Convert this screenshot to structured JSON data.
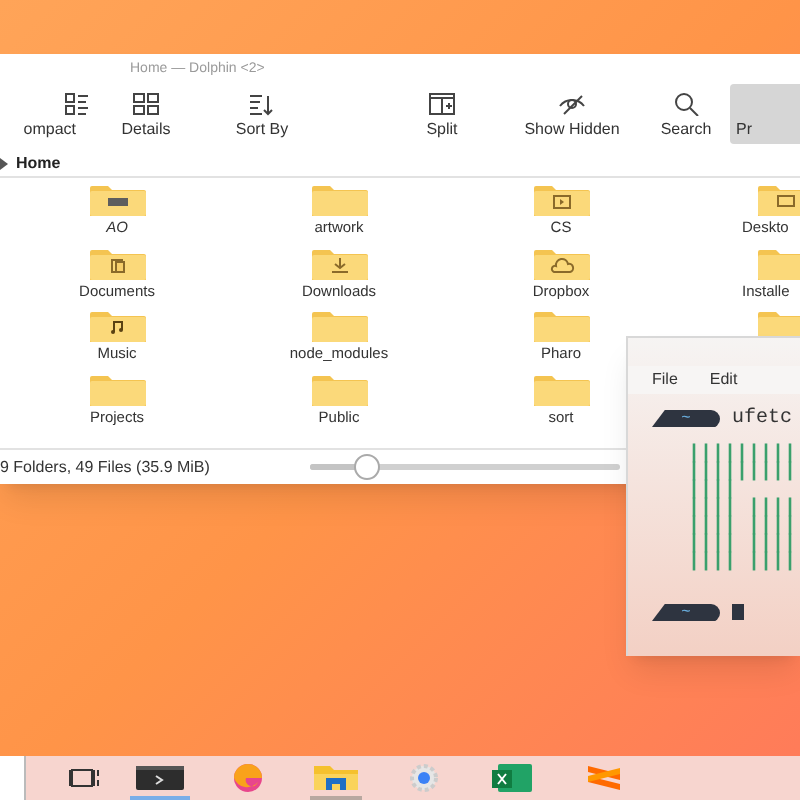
{
  "dolphin": {
    "title": "Home — Dolphin <2>",
    "toolbar": [
      {
        "label": "ompact",
        "kind": "compact",
        "selected": false
      },
      {
        "label": "Details",
        "kind": "details",
        "selected": false
      },
      {
        "label": "Sort By",
        "kind": "sort",
        "selected": false
      },
      {
        "label": "Split",
        "kind": "split",
        "selected": false
      },
      {
        "label": "Show Hidden",
        "kind": "hidden",
        "selected": false
      },
      {
        "label": "Search",
        "kind": "search",
        "selected": false
      },
      {
        "label": "Pr",
        "kind": "preview",
        "selected": true
      }
    ],
    "breadcrumb": "Home",
    "items": [
      {
        "label": "AO",
        "kind": "drive"
      },
      {
        "label": "artwork",
        "kind": "plain"
      },
      {
        "label": "CS",
        "kind": "media"
      },
      {
        "label": "Deskto",
        "kind": "desktop"
      },
      {
        "label": "Documents",
        "kind": "documents"
      },
      {
        "label": "Downloads",
        "kind": "download"
      },
      {
        "label": "Dropbox",
        "kind": "cloud"
      },
      {
        "label": "Installe",
        "kind": "plain"
      },
      {
        "label": "Music",
        "kind": "music"
      },
      {
        "label": "node_modules",
        "kind": "plain"
      },
      {
        "label": "Pharo",
        "kind": "plain"
      },
      {
        "kind": "plain"
      },
      {
        "label": "Projects",
        "kind": "plain"
      },
      {
        "label": "Public",
        "kind": "plain"
      },
      {
        "label": "sort",
        "kind": "plain"
      }
    ],
    "status": "9 Folders, 49 Files (35.9 MiB)",
    "zoom": {
      "level": 0.18
    }
  },
  "terminal": {
    "menu": [
      "File",
      "Edit"
    ],
    "prompt_symbol": "~",
    "command": "ufetc",
    "art": [
      "|||||||||",
      "|||||||||",
      "||||",
      "|||| ||||",
      "|||| ||||",
      "|||| ||||",
      "|||| ||||"
    ],
    "prompt_symbol_2": "~"
  },
  "taskbar": [
    {
      "kind": "taskview",
      "selected": false,
      "running": false
    },
    {
      "kind": "terminal",
      "selected": true,
      "running": true
    },
    {
      "kind": "edge",
      "selected": false,
      "running": false
    },
    {
      "kind": "explorer",
      "selected": false,
      "running": true
    },
    {
      "kind": "settings",
      "selected": false,
      "running": false
    },
    {
      "kind": "excel",
      "selected": false,
      "running": false
    },
    {
      "kind": "sublime",
      "selected": false,
      "running": false
    }
  ]
}
